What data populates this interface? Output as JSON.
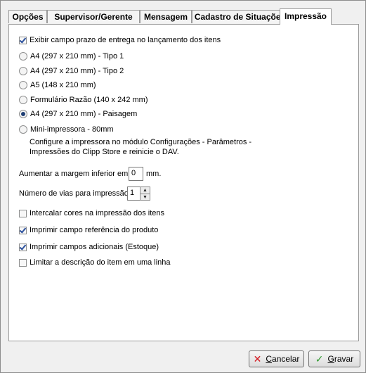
{
  "tabs": [
    "Opções",
    "Supervisor/Gerente",
    "Mensagem",
    "Cadastro de Situações",
    "Impressão"
  ],
  "active_tab": 4,
  "show_delivery_field": {
    "label": "Exibir campo prazo de entrega no lançamento dos itens",
    "checked": true
  },
  "paper_options": [
    {
      "label": "A4 (297 x 210 mm) - Tipo 1",
      "selected": false
    },
    {
      "label": "A4 (297 x 210 mm) - Tipo 2",
      "selected": false
    },
    {
      "label": "A5 (148 x 210 mm)",
      "selected": false
    },
    {
      "label": "Formulário Razão (140 x 242 mm)",
      "selected": false
    },
    {
      "label": "A4 (297 x 210 mm) - Paisagem",
      "selected": true
    },
    {
      "label": "Mini-impressora - 80mm",
      "selected": false
    }
  ],
  "mini_printer_note_1": "Configure a impressora no módulo Configurações - Parâmetros -",
  "mini_printer_note_2": "Impressões do Clipp Store e reinicie o DAV.",
  "bottom_margin": {
    "label": "Aumentar a margem inferior em",
    "value": "0",
    "unit": "mm."
  },
  "copies": {
    "label": "Número de vias para impressão",
    "value": "1"
  },
  "options": [
    {
      "label": "Intercalar cores na impressão dos itens",
      "checked": false
    },
    {
      "label": "Imprimir campo referência do produto",
      "checked": true
    },
    {
      "label": "Imprimir campos adicionais (Estoque)",
      "checked": true
    },
    {
      "label": "Limitar a descrição do item em uma linha",
      "checked": false
    }
  ],
  "buttons": {
    "cancel_prefix": "C",
    "cancel_rest": "ancelar",
    "save_prefix": "G",
    "save_rest": "ravar"
  },
  "icons": {
    "cancel": "x-icon",
    "save": "check-icon"
  },
  "colors": {
    "cancel_icon": "#d3141c",
    "save_icon": "#2e9a2e"
  }
}
